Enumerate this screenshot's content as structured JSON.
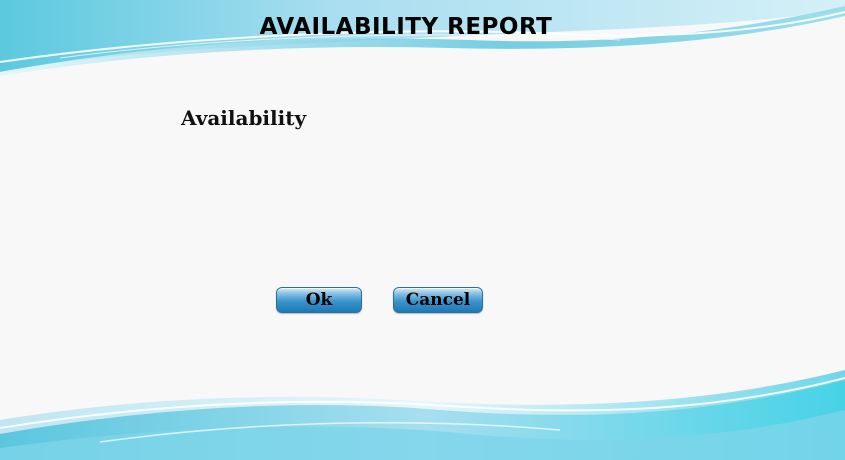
{
  "header": {
    "title": "AVAILABILITY REPORT"
  },
  "form": {
    "label": "Availability"
  },
  "actions": {
    "ok_label": "Ok",
    "cancel_label": "Cancel"
  },
  "colors": {
    "background": "#f8f8f8",
    "wave_light": "#bfe6f2",
    "wave_accent": "#4fc8e0",
    "button_base": "#1c79b5"
  }
}
